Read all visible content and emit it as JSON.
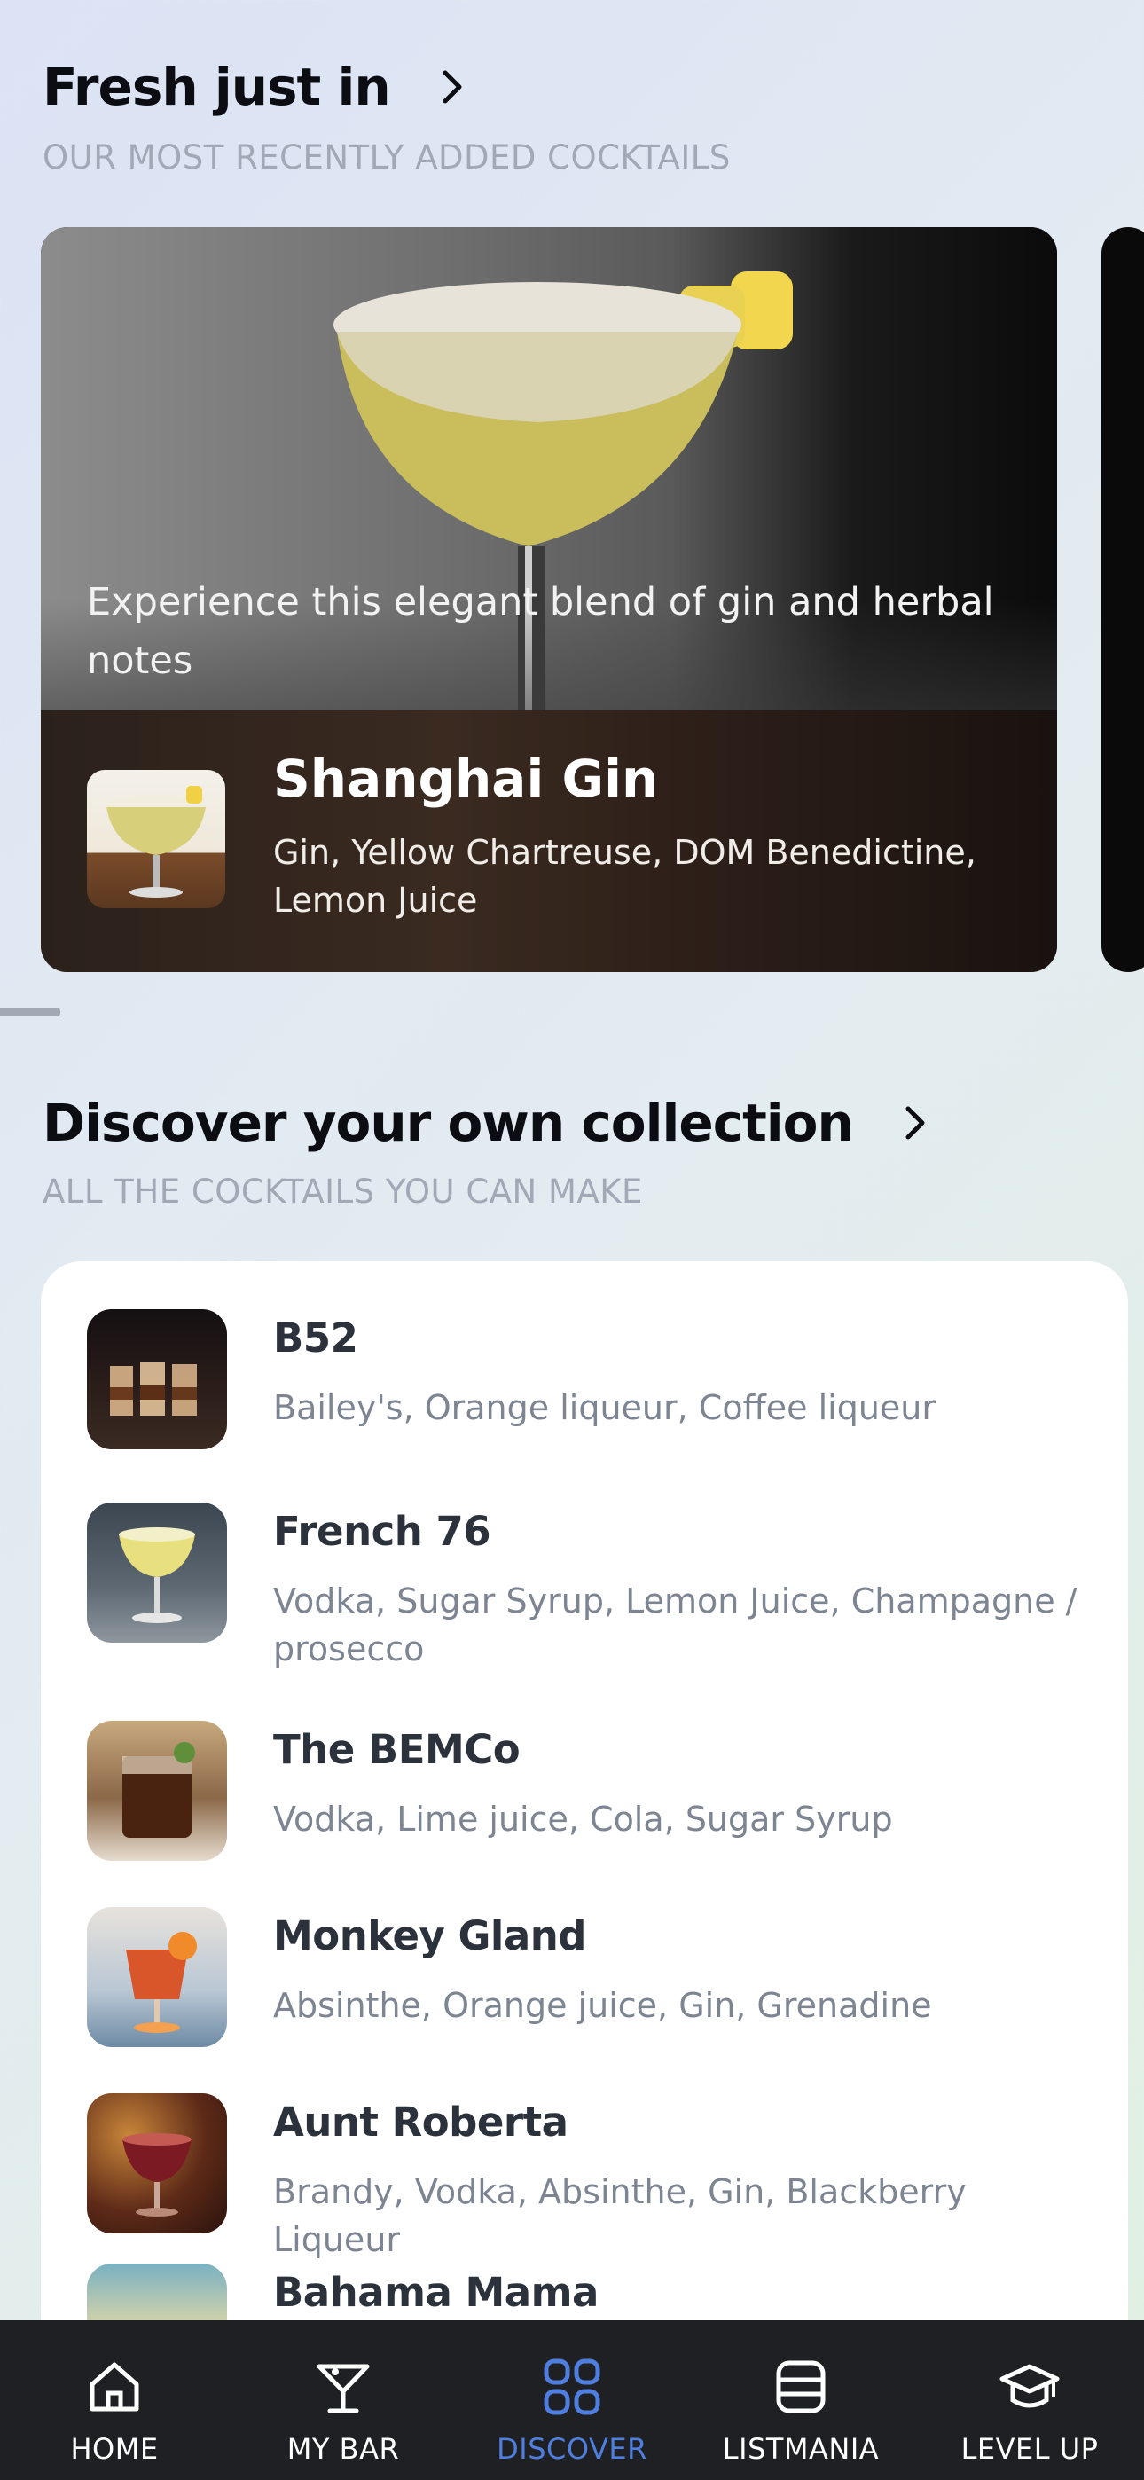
{
  "fresh": {
    "title": "Fresh just in",
    "subtitle": "OUR MOST RECENTLY ADDED COCKTAILS",
    "feature": {
      "description": "Experience this elegant blend of gin and herbal notes",
      "name": "Shanghai Gin",
      "ingredients": "Gin, Yellow Chartreuse, DOM Benedictine, Lemon Juice"
    }
  },
  "collection": {
    "title": "Discover your own collection",
    "subtitle": "ALL THE COCKTAILS YOU CAN MAKE",
    "items": [
      {
        "name": "B52",
        "ingredients": "Bailey's, Orange liqueur, Coffee liqueur"
      },
      {
        "name": "French 76",
        "ingredients": "Vodka, Sugar Syrup, Lemon Juice, Champagne / prosecco"
      },
      {
        "name": "The BEMCo",
        "ingredients": "Vodka, Lime juice, Cola, Sugar Syrup"
      },
      {
        "name": "Monkey Gland",
        "ingredients": "Absinthe, Orange juice, Gin, Grenadine"
      },
      {
        "name": "Aunt Roberta",
        "ingredients": "Brandy, Vodka, Absinthe, Gin, Blackberry Liqueur"
      },
      {
        "name": "Bahama Mama",
        "ingredients": ""
      }
    ]
  },
  "nav": {
    "items": [
      {
        "label": "HOME",
        "icon": "home-icon"
      },
      {
        "label": "MY BAR",
        "icon": "cocktail-glass-icon"
      },
      {
        "label": "DISCOVER",
        "icon": "grid-icon"
      },
      {
        "label": "LISTMANIA",
        "icon": "list-icon"
      },
      {
        "label": "LEVEL UP",
        "icon": "graduation-cap-icon"
      }
    ],
    "active": "DISCOVER",
    "active_color": "#4e7fe0"
  }
}
